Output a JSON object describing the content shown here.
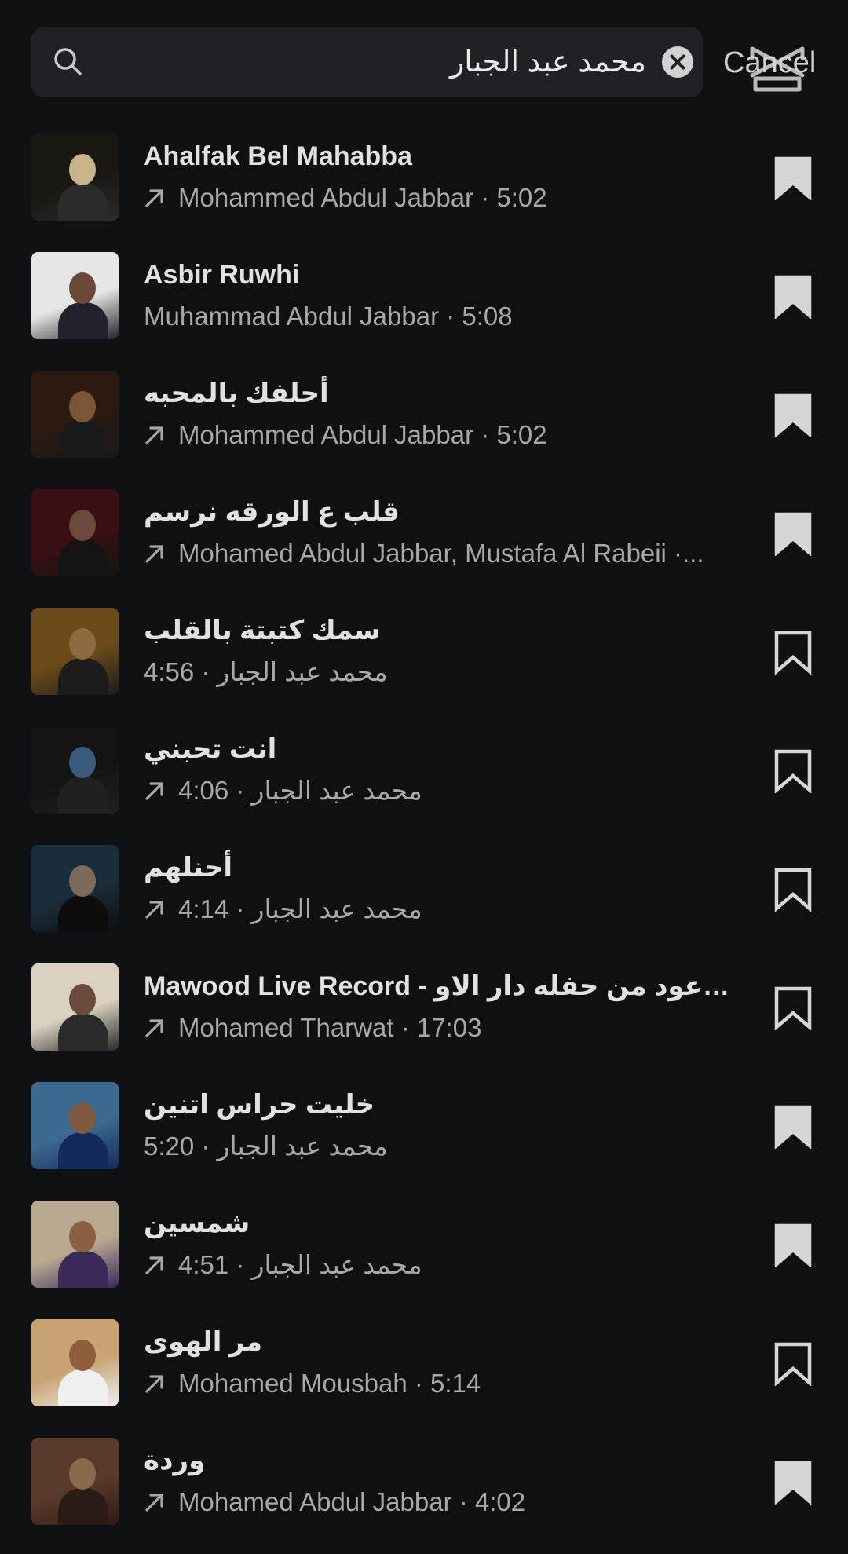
{
  "search": {
    "query": "محمد عبد الجبار",
    "cancel_label": "Cancel"
  },
  "results": [
    {
      "title": "Ahalfak Bel Mahabba",
      "subtitle": "Mohammed Abdul Jabbar · 5:02",
      "has_arrow": true,
      "bookmarked": true
    },
    {
      "title": "Asbir Ruwhi",
      "subtitle": "Muhammad Abdul Jabbar · 5:08",
      "has_arrow": false,
      "bookmarked": true
    },
    {
      "title": "أحلفك بالمحبه",
      "subtitle": "Mohammed Abdul Jabbar · 5:02",
      "has_arrow": true,
      "bookmarked": true
    },
    {
      "title": "قلب ع الورقه نرسم",
      "subtitle": "Mohamed Abdul Jabbar, Mustafa Al Rabeii ·...",
      "has_arrow": true,
      "bookmarked": true
    },
    {
      "title": "سمك كتبتة بالقلب",
      "subtitle": "محمد عبد الجبار · 4:56",
      "has_arrow": false,
      "bookmarked": false
    },
    {
      "title": "انت تحبني",
      "subtitle": "محمد عبد الجبار · 4:06",
      "has_arrow": true,
      "bookmarked": false
    },
    {
      "title": "أحنلهم",
      "subtitle": "محمد عبد الجبار · 4:14",
      "has_arrow": true,
      "bookmarked": false
    },
    {
      "title": "Mawood Live Record - موعود من حفله دار الاو...",
      "subtitle": "Mohamed Tharwat · 17:03",
      "has_arrow": true,
      "bookmarked": false
    },
    {
      "title": "خليت حراس اتنين",
      "subtitle": "محمد عبد الجبار · 5:20",
      "has_arrow": false,
      "bookmarked": true
    },
    {
      "title": "شمسين",
      "subtitle": "محمد عبد الجبار · 4:51",
      "has_arrow": true,
      "bookmarked": true
    },
    {
      "title": "مر الهوى",
      "subtitle": "Mohamed Mousbah · 5:14",
      "has_arrow": true,
      "bookmarked": false
    },
    {
      "title": "وردة",
      "subtitle": "Mohamed Abdul Jabbar · 4:02",
      "has_arrow": true,
      "bookmarked": true
    }
  ],
  "icons": {
    "search": "search-icon",
    "clear": "clear-icon",
    "arrow": "trending-arrow-icon",
    "bookmark": "bookmark-icon"
  },
  "colors": {
    "background": "#0f1013",
    "search_field": "#202126",
    "title": "#e1e1e3",
    "subtitle": "#a8a8ab",
    "icon": "#d6d6d8"
  }
}
